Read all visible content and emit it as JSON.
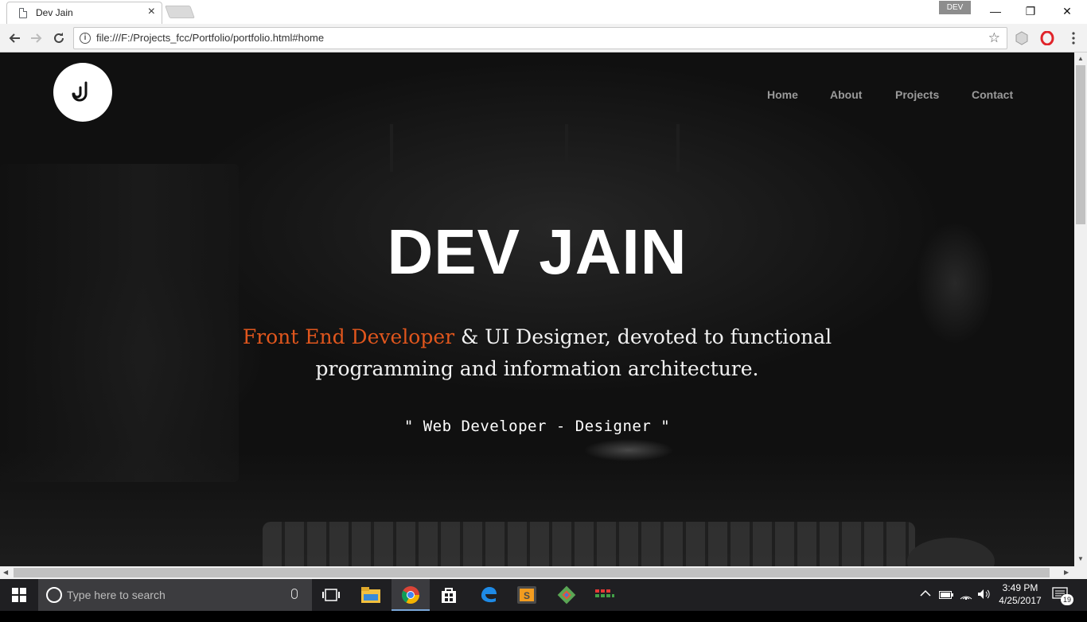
{
  "browser": {
    "tab_title": "Dev Jain",
    "tab_close": "×",
    "profile_label": "DEV",
    "url": "file:///F:/Projects_fcc/Portfolio/portfolio.html#home",
    "window_minimize": "—",
    "window_restore": "❐",
    "window_close": "✕"
  },
  "site": {
    "nav": {
      "items": [
        {
          "label": "Home"
        },
        {
          "label": "About"
        },
        {
          "label": "Projects"
        },
        {
          "label": "Contact"
        }
      ]
    },
    "hero": {
      "name": "DEV JAIN",
      "tagline_accent": "Front End Developer",
      "tagline_rest": " & UI Designer, devoted to functional programming and information architecture.",
      "subtitle": "\" Web Developer - Designer \""
    },
    "colors": {
      "accent": "#e0561d",
      "nav_text": "#9a9a9a"
    }
  },
  "taskbar": {
    "search_placeholder": "Type here to search",
    "time": "3:49 PM",
    "date": "4/25/2017",
    "notification_count": "19",
    "apps": [
      "task-view-icon",
      "file-explorer-icon",
      "chrome-icon",
      "store-icon",
      "edge-icon",
      "sublime-text-icon",
      "git-icon",
      "app-icon"
    ]
  }
}
